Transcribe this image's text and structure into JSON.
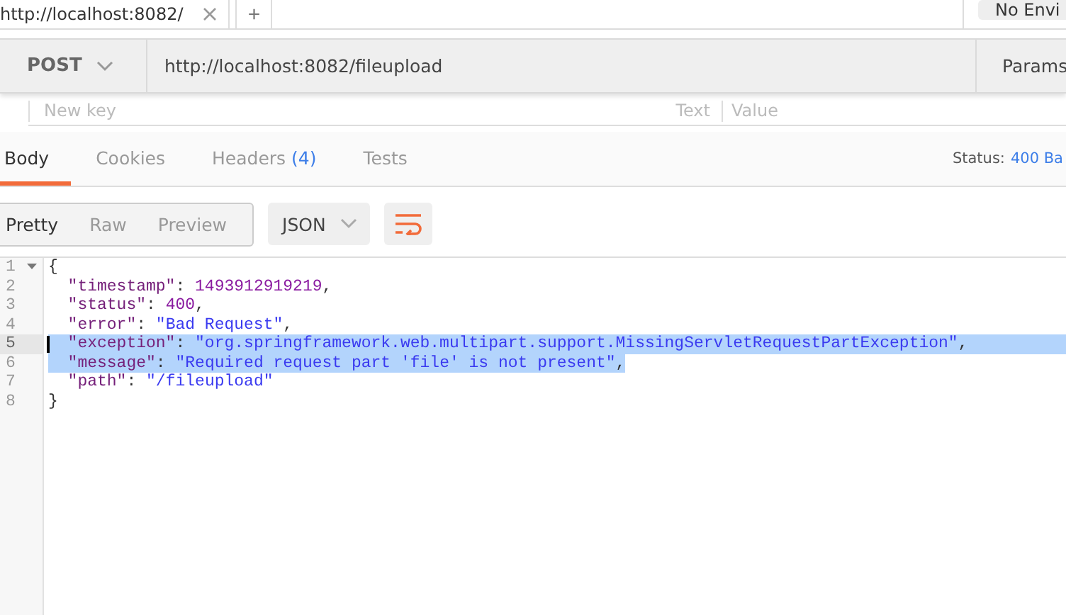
{
  "request_tabs": [
    {
      "label": "http://localhost:8082/",
      "selected": true
    }
  ],
  "new_tab_label": "+",
  "environment_label": "No Envi",
  "request": {
    "method": "POST",
    "url": "http://localhost:8082/fileupload",
    "params_label": "Params"
  },
  "form_row": {
    "key_placeholder": "New key",
    "type": "Text",
    "value_placeholder": "Value"
  },
  "response_tabs": [
    {
      "label": "Body",
      "selected": true
    },
    {
      "label": "Cookies",
      "selected": false
    },
    {
      "label": "Headers",
      "count": "(4)",
      "selected": false
    },
    {
      "label": "Tests",
      "selected": false
    }
  ],
  "status": {
    "label": "Status:",
    "value": "400 Ba"
  },
  "view_modes": [
    {
      "label": "Pretty",
      "selected": true
    },
    {
      "label": "Raw",
      "selected": false
    },
    {
      "label": "Preview",
      "selected": false
    }
  ],
  "format": "JSON",
  "lines": [
    {
      "number": "1",
      "foldable": true,
      "cursor": false,
      "selected": false,
      "tokens": [
        {
          "kind": "punct",
          "text": "{"
        }
      ]
    },
    {
      "number": "2",
      "foldable": false,
      "cursor": false,
      "selected": false,
      "tokens": [
        {
          "kind": "key",
          "text": "\"timestamp\""
        },
        {
          "kind": "punct",
          "text": ": "
        },
        {
          "kind": "number",
          "text": "1493912919219"
        },
        {
          "kind": "punct",
          "text": ","
        }
      ]
    },
    {
      "number": "3",
      "foldable": false,
      "cursor": false,
      "selected": false,
      "tokens": [
        {
          "kind": "key",
          "text": "\"status\""
        },
        {
          "kind": "punct",
          "text": ": "
        },
        {
          "kind": "number",
          "text": "400"
        },
        {
          "kind": "punct",
          "text": ","
        }
      ]
    },
    {
      "number": "4",
      "foldable": false,
      "cursor": false,
      "selected": false,
      "tokens": [
        {
          "kind": "key",
          "text": "\"error\""
        },
        {
          "kind": "punct",
          "text": ": "
        },
        {
          "kind": "string",
          "text": "\"Bad Request\""
        },
        {
          "kind": "punct",
          "text": ","
        }
      ]
    },
    {
      "number": "5",
      "foldable": false,
      "cursor": true,
      "selected": true,
      "tokens": [
        {
          "kind": "key",
          "text": "\"exception\""
        },
        {
          "kind": "punct",
          "text": ": "
        },
        {
          "kind": "string",
          "text": "\"org.springframework.web.multipart.support.MissingServletRequestPartException\""
        },
        {
          "kind": "punct",
          "text": ","
        }
      ]
    },
    {
      "number": "6",
      "foldable": false,
      "cursor": false,
      "selected": true,
      "tokens": [
        {
          "kind": "key",
          "text": "\"message\""
        },
        {
          "kind": "punct",
          "text": ": "
        },
        {
          "kind": "string",
          "text": "\"Required request part 'file' is not present\""
        },
        {
          "kind": "punct",
          "text": ","
        }
      ]
    },
    {
      "number": "7",
      "foldable": false,
      "cursor": false,
      "selected": false,
      "tokens": [
        {
          "kind": "key",
          "text": "\"path\""
        },
        {
          "kind": "punct",
          "text": ": "
        },
        {
          "kind": "string",
          "text": "\"/fileupload\""
        }
      ]
    },
    {
      "number": "8",
      "foldable": false,
      "cursor": false,
      "selected": false,
      "tokens": [
        {
          "kind": "punct",
          "text": "}"
        }
      ]
    }
  ]
}
